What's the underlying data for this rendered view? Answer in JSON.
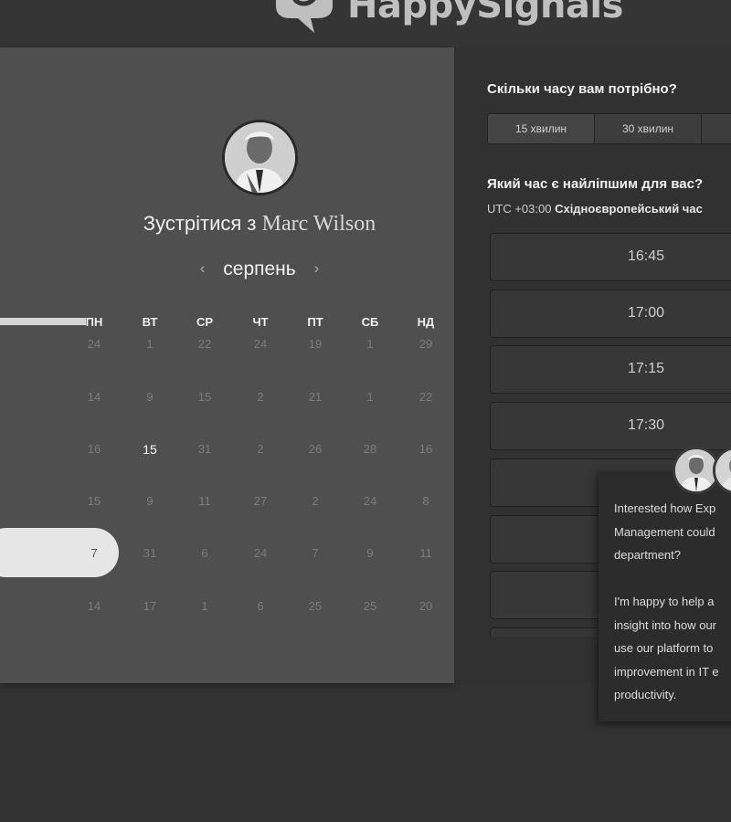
{
  "brand": {
    "name": "HappySignals"
  },
  "meeting": {
    "title_prefix": "Зустрітися з",
    "host_name": "Marc Wilson",
    "avatar_icon": "person-photo-icon"
  },
  "calendar": {
    "month": "серпень",
    "prev_icon": "‹",
    "next_icon": "›",
    "weekdays": [
      "ПН",
      "ВТ",
      "СР",
      "ЧТ",
      "ПТ",
      "СБ",
      "НД"
    ],
    "weeks": [
      [
        "24",
        "1",
        "22",
        "24",
        "19",
        "1",
        "29"
      ],
      [
        "14",
        "9",
        "15",
        "2",
        "21",
        "1",
        "22"
      ],
      [
        "16",
        "15",
        "31",
        "2",
        "26",
        "28",
        "16"
      ],
      [
        "15",
        "9",
        "11",
        "27",
        "2",
        "24",
        "8"
      ],
      [
        "7",
        "31",
        "6",
        "24",
        "7",
        "9",
        "11"
      ],
      [
        "14",
        "17",
        "1",
        "6",
        "25",
        "25",
        "20"
      ]
    ],
    "available_day": "15",
    "selected_day": "7"
  },
  "duration": {
    "question": "Скільки часу вам потрібно?",
    "options": [
      "15 хвилин",
      "30 хвилин",
      ""
    ]
  },
  "time": {
    "question": "Який час є найліпшим для вас?",
    "tz_offset": "UTC +03:00",
    "tz_name": "Східноєвропейський час",
    "slots": [
      "16:45",
      "17:00",
      "17:15",
      "17:30",
      "",
      "",
      ""
    ]
  },
  "chat": {
    "paragraph1": [
      "Interested how Exp",
      "Management could",
      "department?"
    ],
    "paragraph2": [
      "I'm happy to help a",
      "insight into how our",
      "use our platform to",
      "improvement in IT e",
      "productivity."
    ]
  },
  "colors": {
    "page_bg": "#333333",
    "left_panel": "#4f4f4f",
    "right_panel": "#313131",
    "selected_pill": "#e6e6e6"
  }
}
